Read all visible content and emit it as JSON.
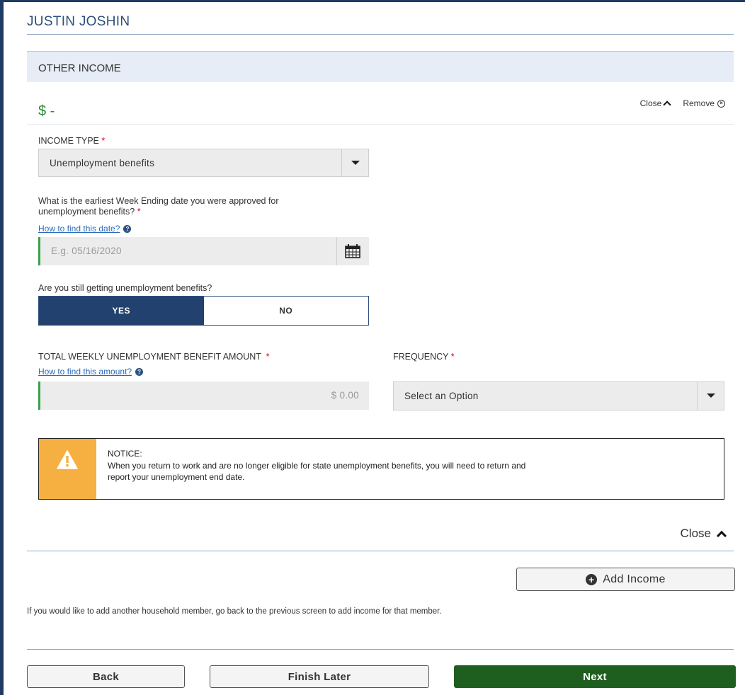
{
  "member": {
    "name": "JUSTIN JOSHIN"
  },
  "section": {
    "title": "OTHER INCOME"
  },
  "income": {
    "amount_display": "$ -",
    "close_label": "Close",
    "remove_label": "Remove"
  },
  "income_type": {
    "label": "INCOME TYPE",
    "required_mark": "*",
    "selected": "Unemployment benefits"
  },
  "week_ending": {
    "question_line1": "What is the earliest Week Ending date you were approved for",
    "question_line2": "unemployment benefits?",
    "required_mark": "*",
    "help_link": "How to find this date?",
    "placeholder": "E.g. 05/16/2020"
  },
  "still_getting": {
    "question": "Are you still getting unemployment benefits?",
    "yes_label": "YES",
    "no_label": "NO",
    "selected": "YES"
  },
  "weekly_amount": {
    "label": "TOTAL WEEKLY UNEMPLOYMENT BENEFIT AMOUNT",
    "required_mark": "*",
    "help_link": "How to find this amount?",
    "placeholder": "$ 0.00"
  },
  "frequency": {
    "label": "FREQUENCY",
    "required_mark": "*",
    "selected": "Select an Option"
  },
  "notice": {
    "title": "NOTICE:",
    "line1": "When you return to work and are no longer eligible for state unemployment benefits, you will need to return and",
    "line2": "report your unemployment end date."
  },
  "footer": {
    "close_label": "Close",
    "add_income_label": "Add Income",
    "hint": "If you would like to add another household member, go back to the previous screen to add income for that member.",
    "back_label": "Back",
    "finish_later_label": "Finish Later",
    "next_label": "Next"
  },
  "colors": {
    "brand_navy": "#22416e",
    "next_green": "#1e5f1f",
    "notice_amber": "#f5b041",
    "amount_green": "#2e8b3a"
  }
}
